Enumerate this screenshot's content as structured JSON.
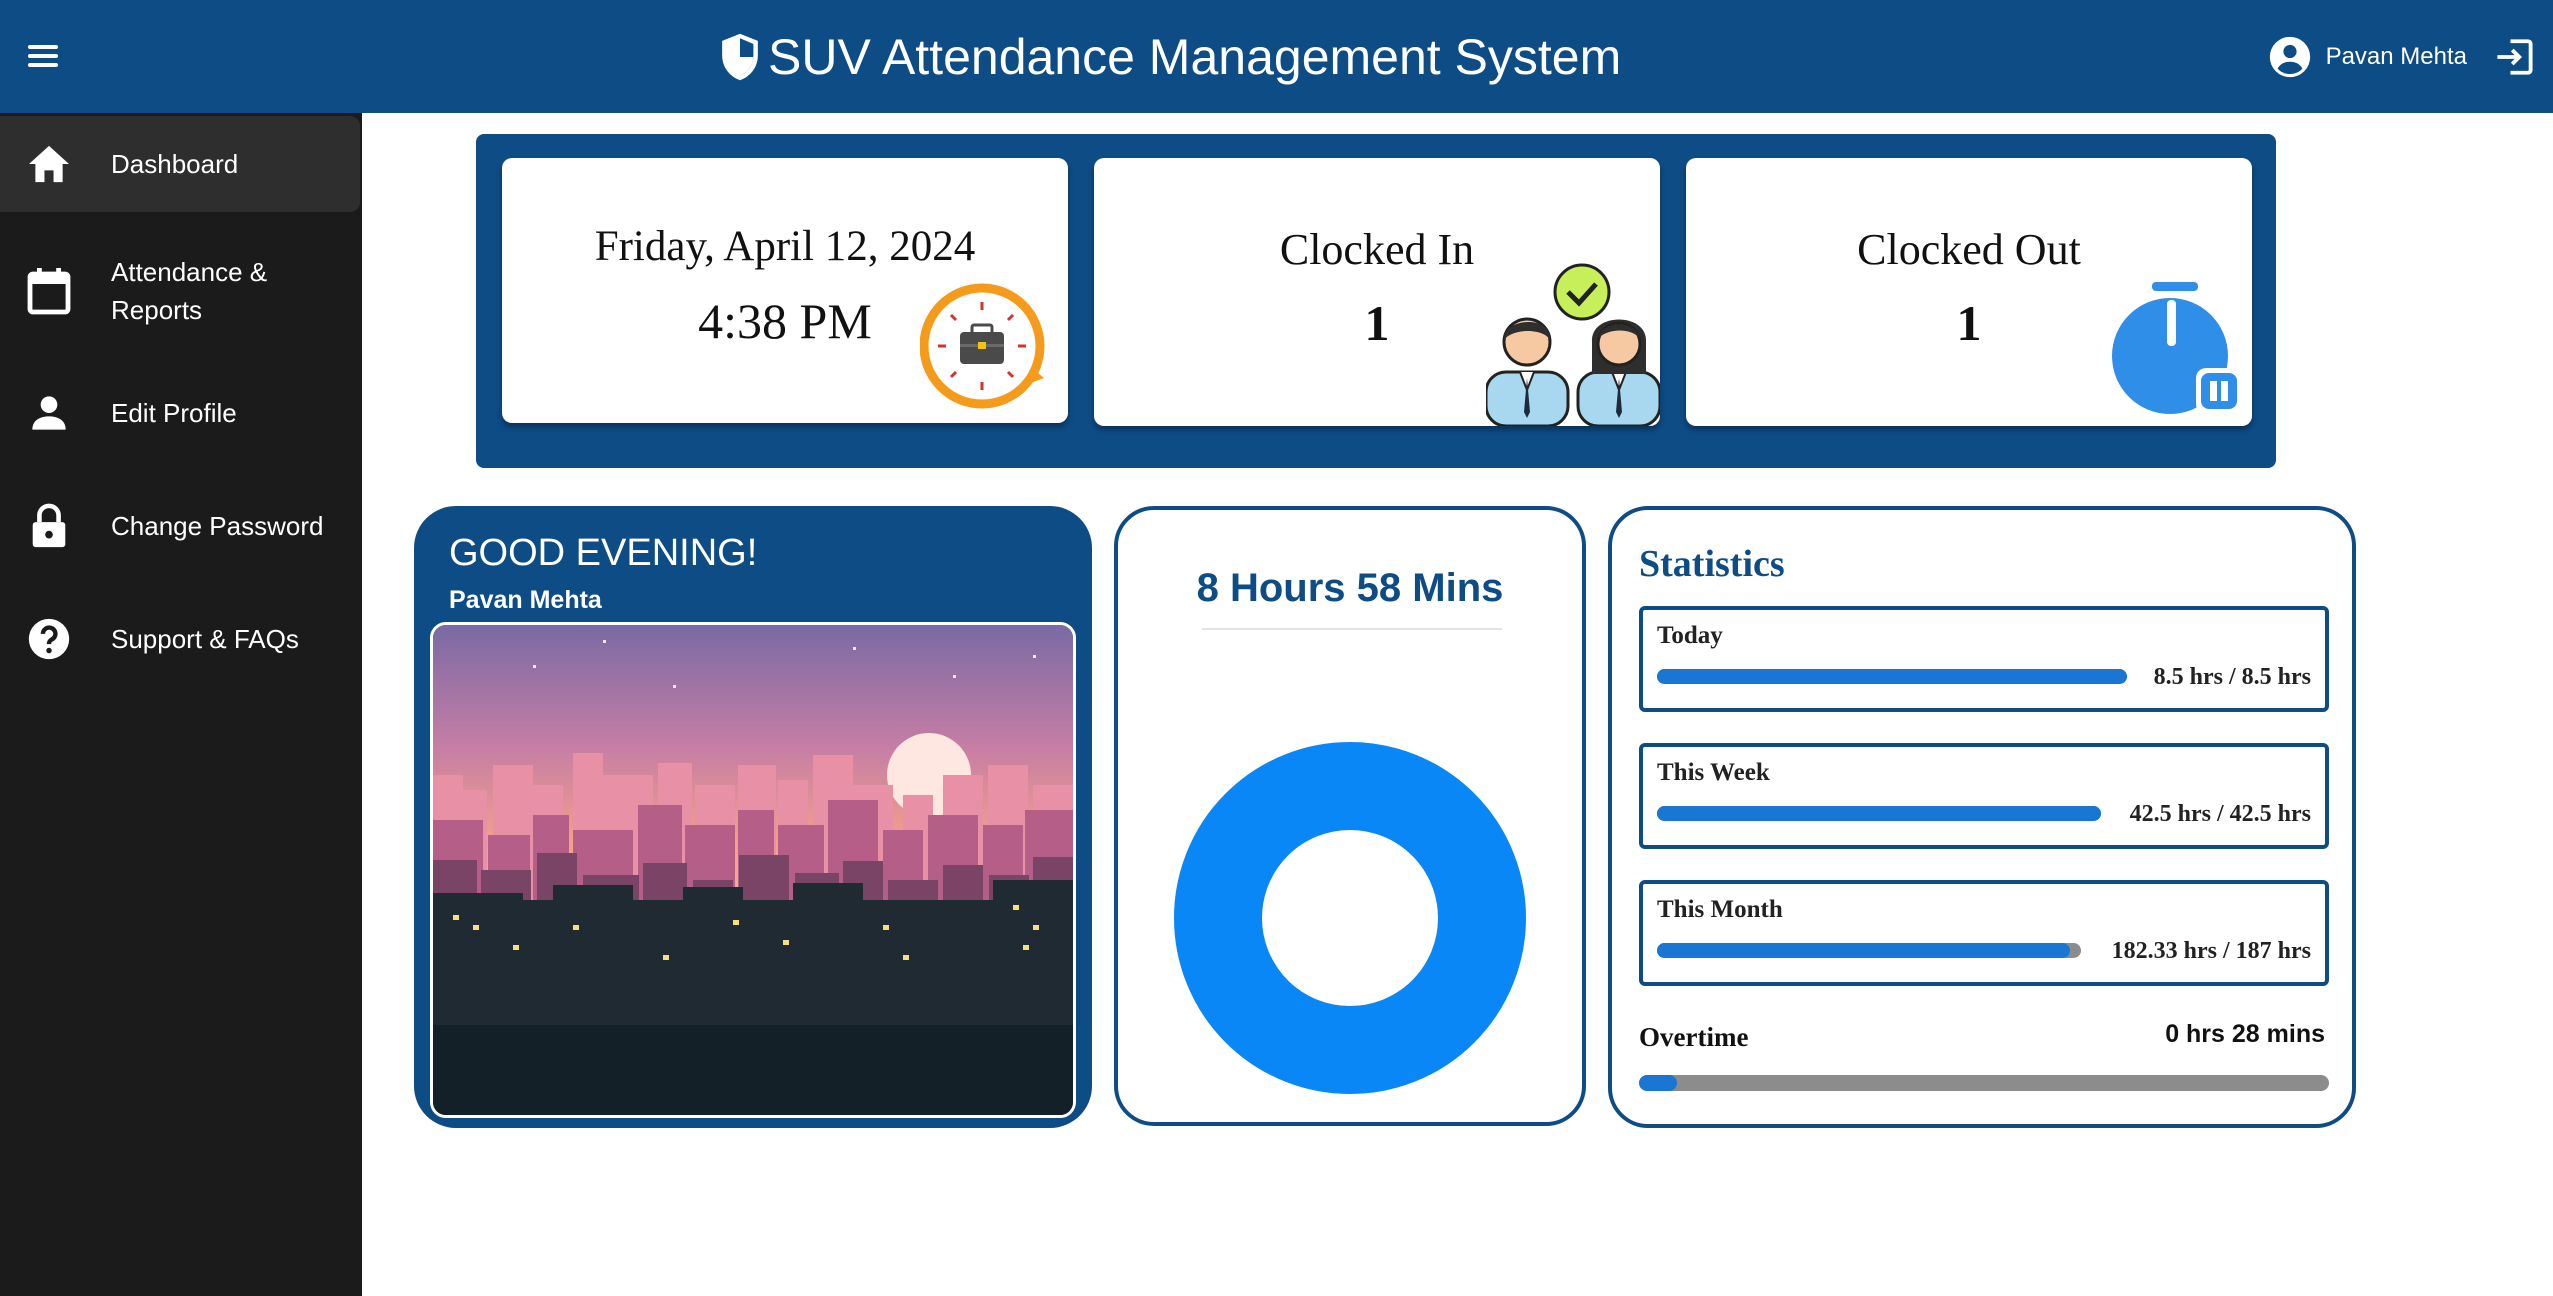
{
  "app": {
    "title": "SUV Attendance Management System"
  },
  "user": {
    "name": "Pavan Mehta"
  },
  "sidebar": {
    "items": [
      {
        "label": "Dashboard",
        "icon": "home-icon"
      },
      {
        "label": "Attendance &\nReports",
        "icon": "calendar-icon"
      },
      {
        "label": "Edit Profile",
        "icon": "person-icon"
      },
      {
        "label": "Change Password",
        "icon": "lock-icon"
      },
      {
        "label": "Support & FAQs",
        "icon": "help-icon"
      }
    ]
  },
  "cards": {
    "date": {
      "date_text": "Friday, April 12, 2024",
      "time_text": "4:38 PM",
      "icon": "clock-briefcase-icon"
    },
    "clocked_in": {
      "label": "Clocked In",
      "count": "1",
      "icon": "employees-check-icon"
    },
    "clocked_out": {
      "label": "Clocked Out",
      "count": "1",
      "icon": "stopwatch-pause-icon"
    }
  },
  "welcome": {
    "greeting": "GOOD EVENING!",
    "name": "Pavan Mehta"
  },
  "hours": {
    "title": "8 Hours 58 Mins",
    "donut_fraction": 1.0
  },
  "statistics": {
    "title": "Statistics",
    "rows": [
      {
        "label": "Today",
        "value": "8.5 hrs / 8.5 hrs",
        "fraction": 1.0
      },
      {
        "label": "This Week",
        "value": "42.5 hrs / 42.5 hrs",
        "fraction": 1.0
      },
      {
        "label": "This Month",
        "value": "182.33 hrs / 187 hrs",
        "fraction": 0.975
      }
    ],
    "overtime": {
      "label": "Overtime",
      "value": "0 hrs 28 mins",
      "fraction": 0.055
    }
  },
  "colors": {
    "brand": "#0e4c86",
    "sidebar": "#1b1b1b",
    "accent": "#1976d2",
    "donut": "#0a87f7"
  }
}
